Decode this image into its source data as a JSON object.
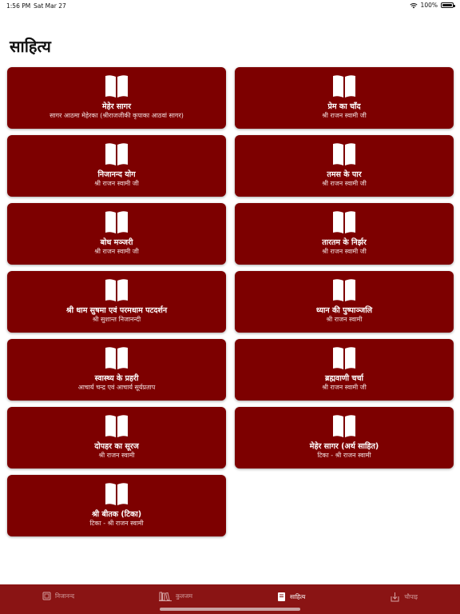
{
  "status": {
    "time": "1:56 PM",
    "date": "Sat Mar 27",
    "battery": "100%"
  },
  "page_title": "साहित्य",
  "books": [
    {
      "title": "मेहेर सागर",
      "author": "सागर आठमा मेहेरका (श्रीराजजीकी कृपाका आठवां सागर)"
    },
    {
      "title": "प्रेम का चाँद",
      "author": "श्री राजन स्वामी जी"
    },
    {
      "title": "निजानन्द योग",
      "author": "श्री राजन स्वामी जी"
    },
    {
      "title": "तमस के पार",
      "author": "श्री राजन स्वामी जी"
    },
    {
      "title": "बोध मञ्जरी",
      "author": "श्री राजन स्वामी जी"
    },
    {
      "title": "तारतम के निर्झर",
      "author": "श्री राजन स्वामी जी"
    },
    {
      "title": "श्री धाम सुषमा एवं परमधाम पटदर्शन",
      "author": "श्री सुशान्त निजानन्दी"
    },
    {
      "title": "ध्यान की पुष्पाञ्जलि",
      "author": "श्री राजन स्वामी"
    },
    {
      "title": "स्वास्थ्य के प्रहरी",
      "author": "आचार्य चन्द्र एवं आचार्य सूर्यप्रताप"
    },
    {
      "title": "ब्रह्मवाणी चर्चा",
      "author": "श्री राजन स्वामी जी"
    },
    {
      "title": "दोपहर का सूरज",
      "author": "श्री राजन स्वामी"
    },
    {
      "title": "मेहेर सागर (अर्थ साहित)",
      "author": "टिका - श्री राजन स्वामी"
    },
    {
      "title": "श्री बीतक (टिका)",
      "author": "टिका - श्री राजन स्वामी"
    }
  ],
  "tabs": [
    {
      "label": "निजानन्द",
      "icon": "square-icon",
      "active": false
    },
    {
      "label": "कुलजम",
      "icon": "library-icon",
      "active": false
    },
    {
      "label": "साहित्य",
      "icon": "book-icon",
      "active": true
    },
    {
      "label": "चौपाइ",
      "icon": "download-icon",
      "active": false
    }
  ],
  "colors": {
    "card": "#7d0000",
    "tab_bar": "#8a1414"
  }
}
